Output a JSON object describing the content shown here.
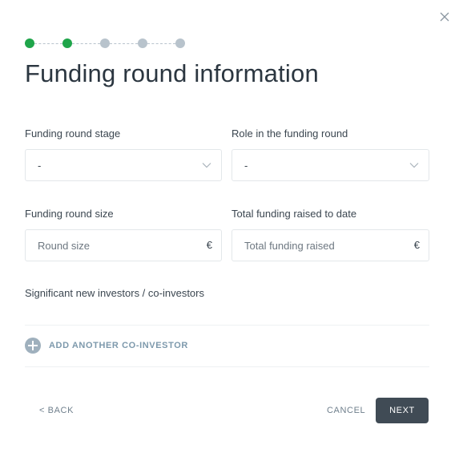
{
  "header": {
    "close_icon": "close-icon",
    "title": "Funding round information"
  },
  "steps": {
    "total": 5,
    "completed": 2,
    "done_color": "#1fa54a",
    "pending_color": "#b8c3cc"
  },
  "form": {
    "stage": {
      "label": "Funding round stage",
      "value": "-",
      "icon": "chevron-down-icon"
    },
    "role": {
      "label": "Role in the funding round",
      "value": "-",
      "icon": "chevron-down-icon"
    },
    "size": {
      "label": "Funding round size",
      "placeholder": "Round size",
      "unit": "€"
    },
    "total": {
      "label": "Total funding raised to date",
      "placeholder": "Total funding raised",
      "unit": "€"
    }
  },
  "investors": {
    "label": "Significant new investors / co-investors",
    "add_label": "ADD ANOTHER CO-INVESTOR",
    "add_icon": "plus-circle-icon"
  },
  "footer": {
    "back_label": "< BACK",
    "cancel_label": "CANCEL",
    "next_label": "NEXT"
  }
}
